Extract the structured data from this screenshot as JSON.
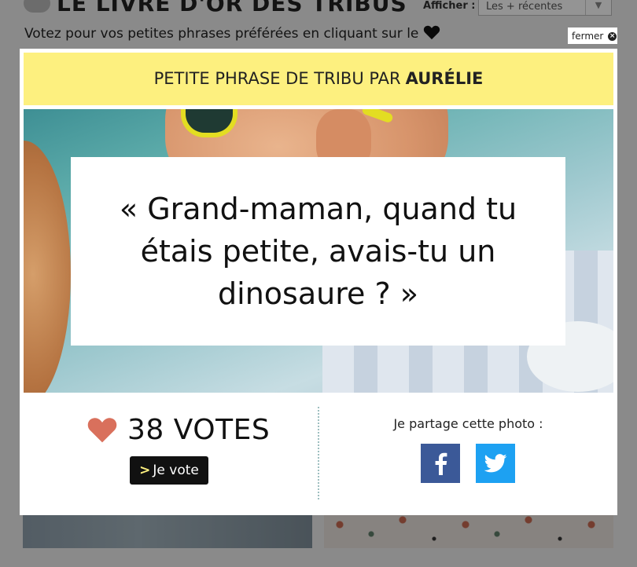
{
  "background_page": {
    "title": "LE LIVRE D'OR DES TRIBUS",
    "subtitle": "Votez pour vos petites phrases préférées en cliquant sur le",
    "filter_label": "Afficher :",
    "filter_value": "Les + récentes"
  },
  "modal": {
    "close_label": "fermer",
    "header_prefix": "PETITE PHRASE DE TRIBU PAR",
    "author": "AURÉLIE",
    "quote": "« Grand-maman, quand tu étais petite, avais-tu un dinosaure ? »",
    "votes": "38 VOTES",
    "vote_button_chevron": ">",
    "vote_button": "Je vote",
    "share_label": "Je partage cette photo :"
  },
  "icons": {
    "heart": "heart-icon",
    "speech": "speech-bubble-icon",
    "close": "close-icon",
    "facebook": "facebook-icon",
    "twitter": "twitter-icon",
    "chevron": "chevron-down-icon"
  },
  "colors": {
    "header_yellow": "#fdf07f",
    "heart_salmon": "#d9705c",
    "facebook_blue": "#3b5998",
    "twitter_blue": "#1da1f2"
  }
}
